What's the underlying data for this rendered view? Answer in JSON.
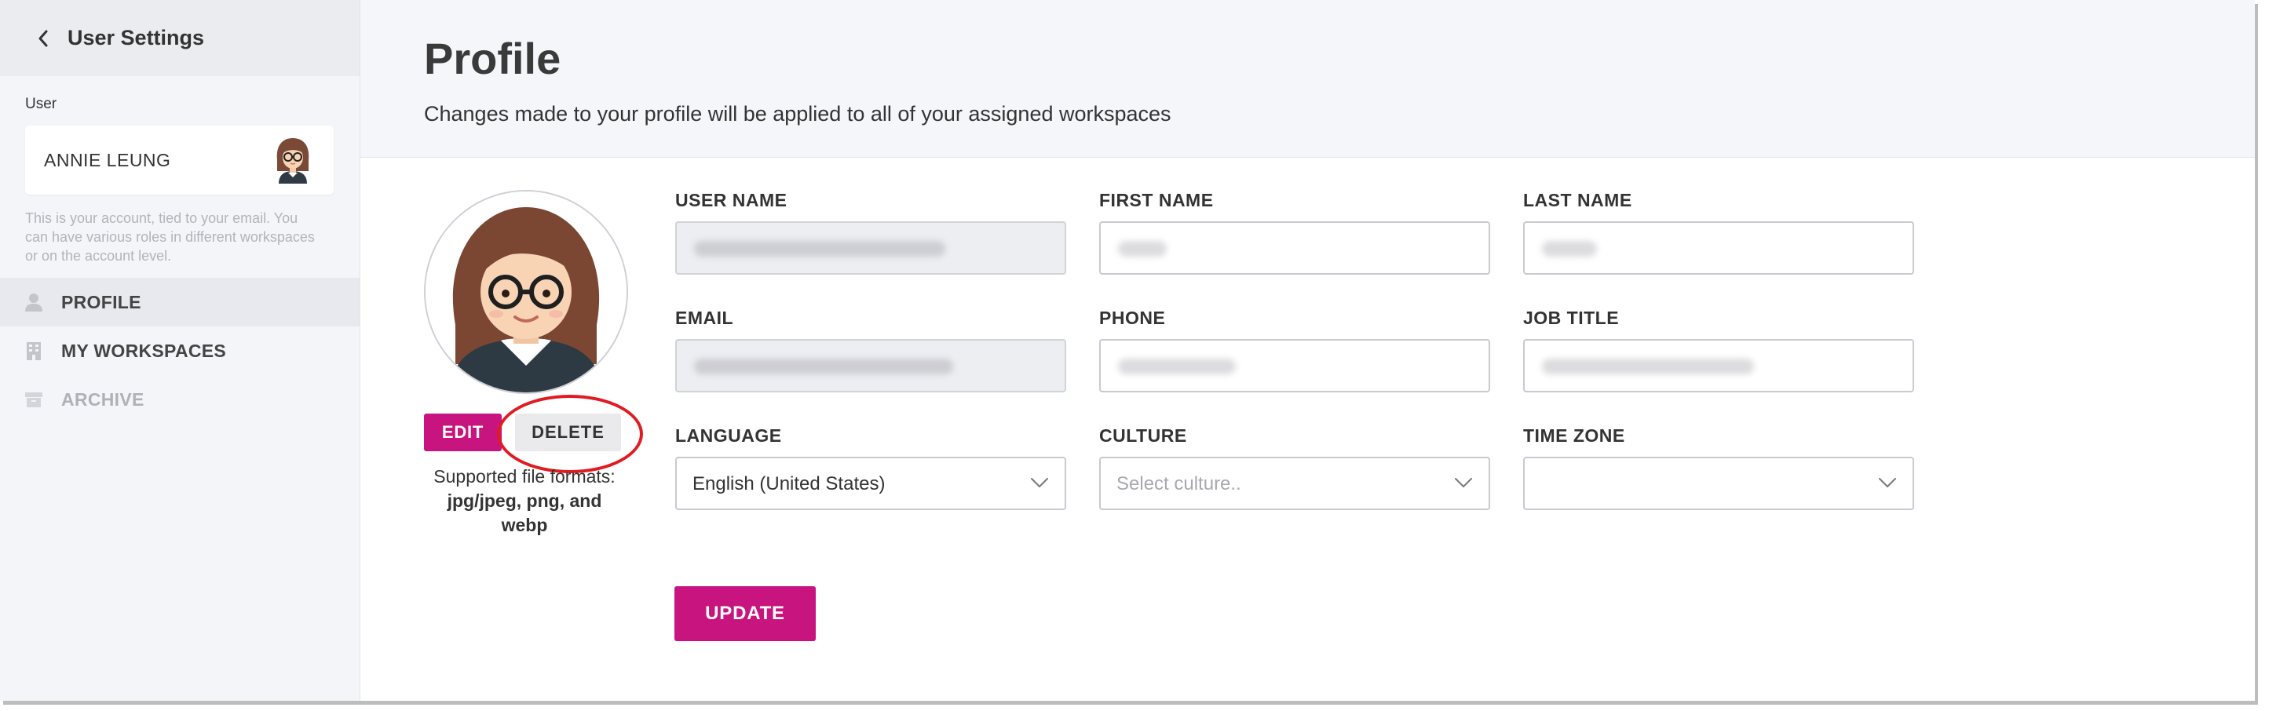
{
  "sidebar": {
    "title": "User Settings",
    "user_label": "User",
    "user_name": "ANNIE LEUNG",
    "help_text": "This is your account, tied to your email. You can have various roles in different workspaces or on the account level.",
    "nav": [
      {
        "label": "PROFILE",
        "icon": "person-icon",
        "state": "active"
      },
      {
        "label": "MY WORKSPACES",
        "icon": "building-icon",
        "state": "normal"
      },
      {
        "label": "ARCHIVE",
        "icon": "archive-icon",
        "state": "disabled"
      }
    ]
  },
  "header": {
    "title": "Profile",
    "subtitle": "Changes made to your profile will be applied to all of your assigned workspaces"
  },
  "avatar": {
    "edit_label": "EDIT",
    "delete_label": "DELETE",
    "formats_line1": "Supported file formats:",
    "formats_line2": "jpg/jpeg, png, and webp"
  },
  "form": {
    "user_name_label": "USER NAME",
    "first_name_label": "FIRST NAME",
    "last_name_label": "LAST NAME",
    "email_label": "EMAIL",
    "phone_label": "PHONE",
    "job_title_label": "JOB TITLE",
    "language_label": "LANGUAGE",
    "language_value": "English (United States)",
    "culture_label": "CULTURE",
    "culture_placeholder": "Select culture..",
    "time_zone_label": "TIME ZONE",
    "time_zone_value": ""
  },
  "update_label": "UPDATE",
  "colors": {
    "accent": "#c8147e",
    "highlight_circle": "#e11b22"
  }
}
